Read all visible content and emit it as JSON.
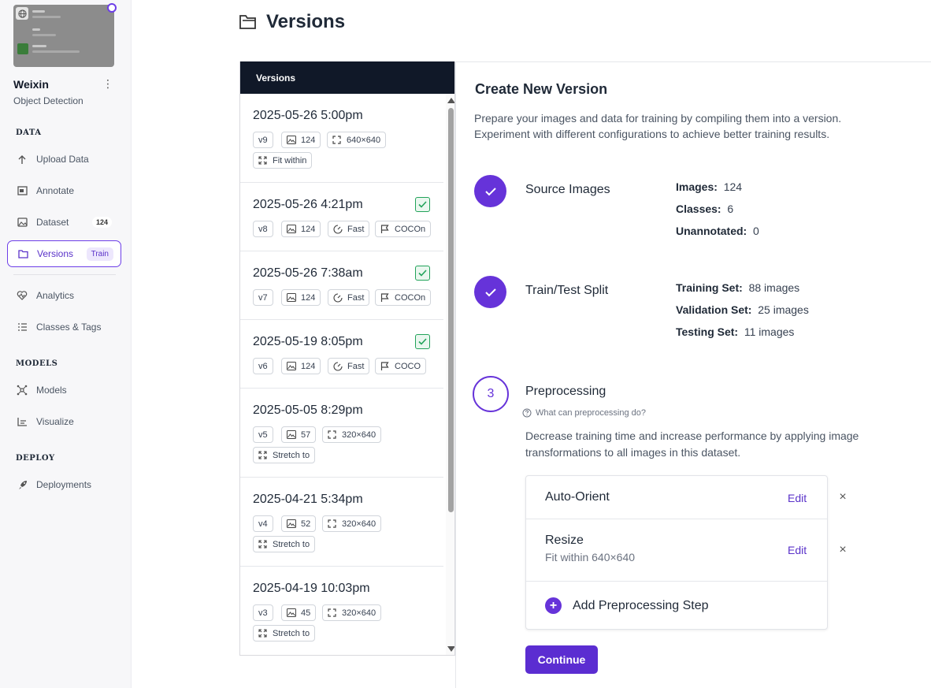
{
  "project": {
    "name": "Weixin",
    "type": "Object Detection",
    "menu_icon": "⋮"
  },
  "sidebar": {
    "sections": [
      {
        "label": "DATA"
      },
      {
        "label": "MODELS"
      },
      {
        "label": "DEPLOY"
      }
    ],
    "items": [
      {
        "label": "Upload Data",
        "icon": "upload-icon"
      },
      {
        "label": "Annotate",
        "icon": "annotate-icon"
      },
      {
        "label": "Dataset",
        "icon": "image-icon",
        "badge": "124"
      },
      {
        "label": "Versions",
        "icon": "folder-icon",
        "badge": "Train",
        "active": true
      },
      {
        "label": "Analytics",
        "icon": "heart-pulse-icon"
      },
      {
        "label": "Classes & Tags",
        "icon": "list-icon"
      },
      {
        "label": "Models",
        "icon": "network-icon"
      },
      {
        "label": "Visualize",
        "icon": "chart-icon"
      },
      {
        "label": "Deployments",
        "icon": "rocket-icon"
      }
    ]
  },
  "header": {
    "title": "Versions"
  },
  "versions_panel": {
    "title": "Versions",
    "items": [
      {
        "date": "2025-05-26 5:00pm",
        "version": "v9",
        "images": "124",
        "size": "640×640",
        "resize": "Fit within",
        "checked": false
      },
      {
        "date": "2025-05-26 4:21pm",
        "version": "v8",
        "images": "124",
        "speed": "Fast",
        "export": "COCOn",
        "checked": true
      },
      {
        "date": "2025-05-26 7:38am",
        "version": "v7",
        "images": "124",
        "speed": "Fast",
        "export": "COCOn",
        "checked": true
      },
      {
        "date": "2025-05-19 8:05pm",
        "version": "v6",
        "images": "124",
        "speed": "Fast",
        "export": "COCO",
        "checked": true
      },
      {
        "date": "2025-05-05 8:29pm",
        "version": "v5",
        "images": "57",
        "size": "320×640",
        "resize": "Stretch to",
        "checked": false
      },
      {
        "date": "2025-04-21 5:34pm",
        "version": "v4",
        "images": "52",
        "size": "320×640",
        "resize": "Stretch to",
        "checked": false
      },
      {
        "date": "2025-04-19 10:03pm",
        "version": "v3",
        "images": "45",
        "size": "320×640",
        "resize": "Stretch to",
        "checked": false
      }
    ]
  },
  "create": {
    "title": "Create New Version",
    "description": "Prepare your images and data for training by compiling them into a version. Experiment with different configurations to achieve better training results.",
    "source": {
      "title": "Source Images",
      "stats": [
        {
          "label": "Images:",
          "value": "124"
        },
        {
          "label": "Classes:",
          "value": "6"
        },
        {
          "label": "Unannotated:",
          "value": "0"
        }
      ]
    },
    "split": {
      "title": "Train/Test Split",
      "stats": [
        {
          "label": "Training Set:",
          "value": "88 images"
        },
        {
          "label": "Validation Set:",
          "value": "25 images"
        },
        {
          "label": "Testing Set:",
          "value": "11 images"
        }
      ]
    },
    "preprocessing": {
      "step_number": "3",
      "title": "Preprocessing",
      "help": "What can preprocessing do?",
      "description": "Decrease training time and increase performance by applying image transformations to all images in this dataset.",
      "steps": [
        {
          "name": "Auto-Orient",
          "detail": "",
          "edit": "Edit",
          "remove": "×"
        },
        {
          "name": "Resize",
          "detail": "Fit within 640×640",
          "edit": "Edit",
          "remove": "×"
        }
      ],
      "add_label": "Add Preprocessing Step",
      "add_symbol": "+"
    },
    "continue_label": "Continue"
  },
  "colors": {
    "accent": "#6633d9",
    "dark_header": "#101828",
    "check_green": "#22a35a"
  }
}
